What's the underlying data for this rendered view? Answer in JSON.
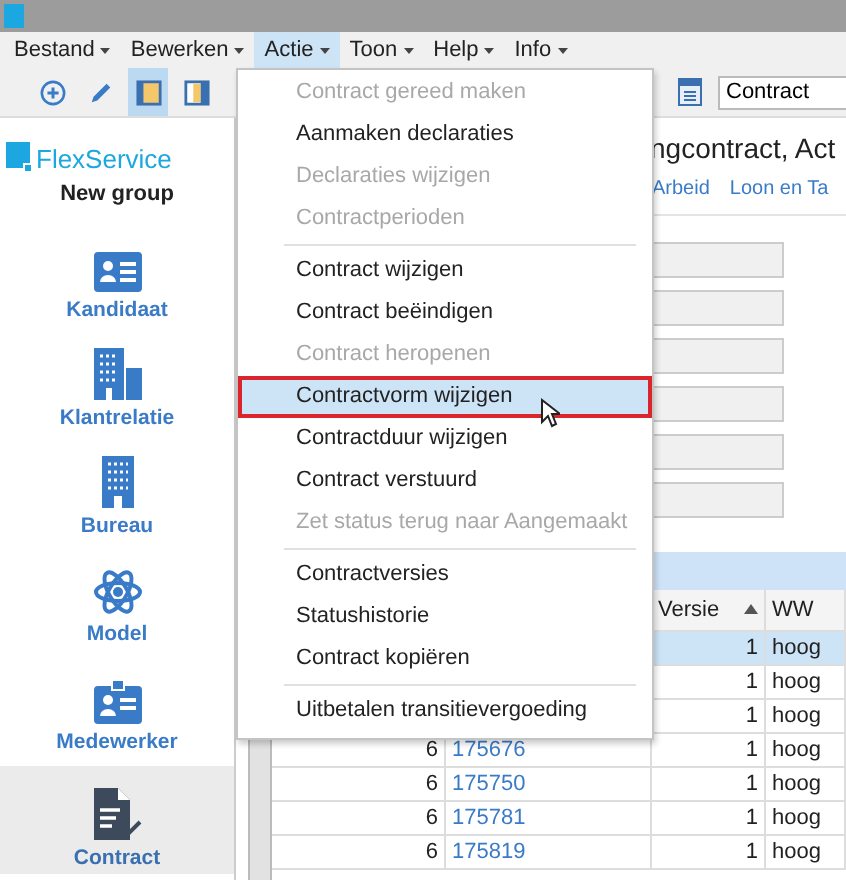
{
  "menubar": [
    {
      "label": "Bestand",
      "selected": false
    },
    {
      "label": "Bewerken",
      "selected": false
    },
    {
      "label": "Actie",
      "selected": true
    },
    {
      "label": "Toon",
      "selected": false
    },
    {
      "label": "Help",
      "selected": false
    },
    {
      "label": "Info",
      "selected": false
    }
  ],
  "toolbar": [
    {
      "kind": "add",
      "selected": false
    },
    {
      "kind": "edit",
      "selected": false
    },
    {
      "kind": "panel",
      "selected": true
    },
    {
      "kind": "split",
      "selected": false
    }
  ],
  "search": {
    "value": "Contract"
  },
  "sidebar": {
    "logo": "FlexService",
    "group": "New group",
    "items": [
      {
        "label": "Kandidaat",
        "kind": "card",
        "selected": false
      },
      {
        "label": "Klantrelatie",
        "kind": "buildings",
        "selected": false
      },
      {
        "label": "Bureau",
        "kind": "building",
        "selected": false
      },
      {
        "label": "Model",
        "kind": "atom",
        "selected": false
      },
      {
        "label": "Medewerker",
        "kind": "badge",
        "selected": false
      },
      {
        "label": "Contract",
        "kind": "document",
        "selected": true
      }
    ]
  },
  "content": {
    "title": "ngcontract, Act",
    "links": [
      "Arbeid",
      "Loon en Ta"
    ]
  },
  "table": {
    "columns": [
      "Versie",
      "WW"
    ],
    "rows": [
      {
        "number": "",
        "id": "",
        "version": "1",
        "ww": "hoog",
        "selected": true
      },
      {
        "number": "",
        "id": "",
        "version": "1",
        "ww": "hoog",
        "selected": false
      },
      {
        "number": "",
        "id": "",
        "version": "1",
        "ww": "hoog",
        "selected": false
      },
      {
        "number": "6",
        "id": "175676",
        "version": "1",
        "ww": "hoog",
        "selected": false
      },
      {
        "number": "6",
        "id": "175750",
        "version": "1",
        "ww": "hoog",
        "selected": false
      },
      {
        "number": "6",
        "id": "175781",
        "version": "1",
        "ww": "hoog",
        "selected": false
      },
      {
        "number": "6",
        "id": "175819",
        "version": "1",
        "ww": "hoog",
        "selected": false
      }
    ]
  },
  "menu": [
    {
      "kind": "item",
      "label": "Contract gereed maken",
      "disabled": true,
      "selected": false
    },
    {
      "kind": "item",
      "label": "Aanmaken declaraties",
      "disabled": false,
      "selected": false
    },
    {
      "kind": "item",
      "label": "Declaraties wijzigen",
      "disabled": true,
      "selected": false
    },
    {
      "kind": "item",
      "label": "Contractperioden",
      "disabled": true,
      "selected": false
    },
    {
      "kind": "separator"
    },
    {
      "kind": "item",
      "label": "Contract wijzigen",
      "disabled": false,
      "selected": false
    },
    {
      "kind": "item",
      "label": "Contract beëindigen",
      "disabled": false,
      "selected": false
    },
    {
      "kind": "item",
      "label": "Contract heropenen",
      "disabled": true,
      "selected": false
    },
    {
      "kind": "item",
      "label": "Contractvorm wijzigen",
      "disabled": false,
      "selected": true
    },
    {
      "kind": "item",
      "label": "Contractduur wijzigen",
      "disabled": false,
      "selected": false
    },
    {
      "kind": "item",
      "label": "Contract verstuurd",
      "disabled": false,
      "selected": false
    },
    {
      "kind": "item",
      "label": "Zet status terug naar Aangemaakt",
      "disabled": true,
      "selected": false
    },
    {
      "kind": "separator"
    },
    {
      "kind": "item",
      "label": "Contractversies",
      "disabled": false,
      "selected": false
    },
    {
      "kind": "item",
      "label": "Statushistorie",
      "disabled": false,
      "selected": false
    },
    {
      "kind": "item",
      "label": "Contract kopiëren",
      "disabled": false,
      "selected": false
    },
    {
      "kind": "separator"
    },
    {
      "kind": "item",
      "label": "Uitbetalen transitievergoeding",
      "disabled": false,
      "selected": false
    }
  ]
}
